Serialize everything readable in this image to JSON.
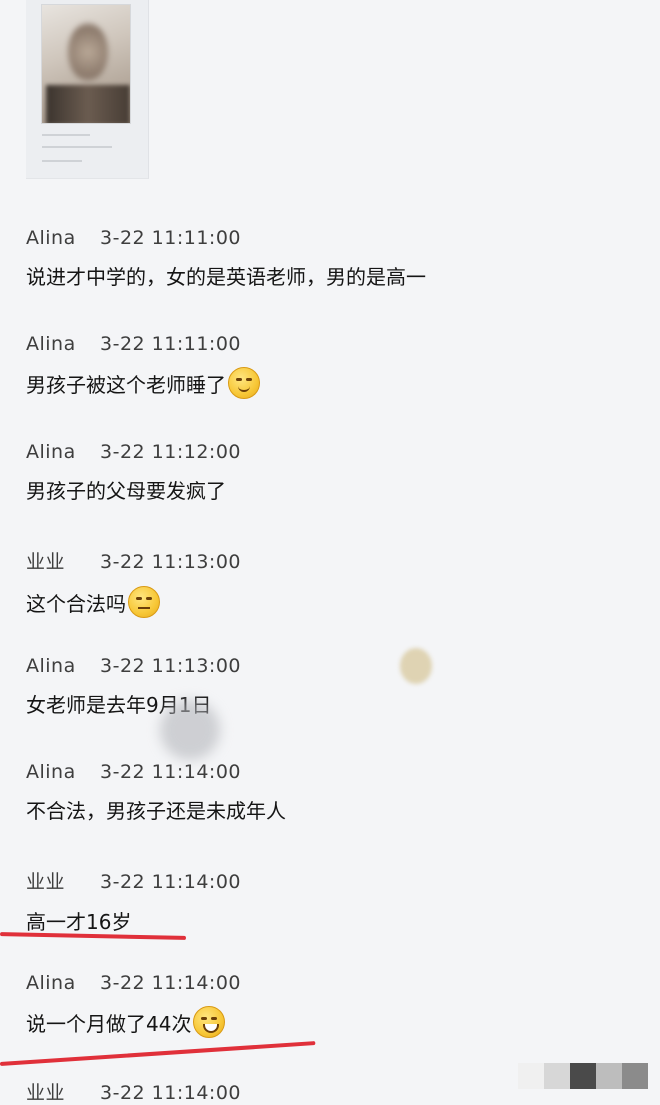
{
  "messages": [
    {
      "sender": "Alina",
      "time": "3-22 11:11:00",
      "text": "说进才中学的，女的是英语老师，男的是高一",
      "emoji": ""
    },
    {
      "sender": "Alina",
      "time": "3-22 11:11:00",
      "text": "男孩子被这个老师睡了",
      "emoji": "laughing-crying-emoji"
    },
    {
      "sender": "Alina",
      "time": "3-22 11:12:00",
      "text": "男孩子的父母要发疯了",
      "emoji": ""
    },
    {
      "sender": "业业",
      "time": "3-22 11:13:00",
      "text": "这个合法吗",
      "emoji": "awkward-sweat-emoji"
    },
    {
      "sender": "Alina",
      "time": "3-22 11:13:00",
      "text": "女老师是去年9月1日",
      "emoji": ""
    },
    {
      "sender": "Alina",
      "time": "3-22 11:14:00",
      "text": "不合法，男孩子还是未成年人",
      "emoji": ""
    },
    {
      "sender": "业业",
      "time": "3-22 11:14:00",
      "text": "高一才16岁",
      "emoji": ""
    },
    {
      "sender": "Alina",
      "time": "3-22 11:14:00",
      "text": "说一个月做了44次",
      "emoji": "grin-emoji"
    },
    {
      "sender": "业业",
      "time": "3-22 11:14:00",
      "text": "",
      "emoji": ""
    }
  ],
  "colors": {
    "background": "#f4f5f7",
    "highlight": "#e0303a"
  }
}
